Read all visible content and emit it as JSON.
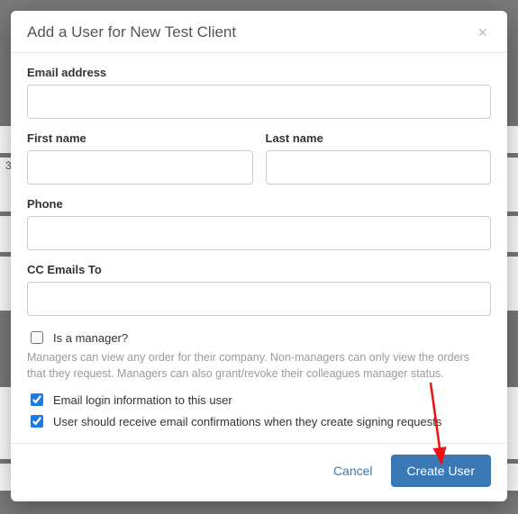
{
  "modal": {
    "title": "Add a User for New Test Client",
    "close": "×",
    "fields": {
      "email_label": "Email address",
      "first_name_label": "First name",
      "last_name_label": "Last name",
      "phone_label": "Phone",
      "cc_label": "CC Emails To",
      "email_value": "",
      "first_name_value": "",
      "last_name_value": "",
      "phone_value": "",
      "cc_value": ""
    },
    "checkboxes": {
      "is_manager_label": "Is a manager?",
      "is_manager_checked": false,
      "manager_help": "Managers can view any order for their company. Non-managers can only view the orders that they request. Managers can also grant/revoke their colleagues manager status.",
      "email_login_label": "Email login information to this user",
      "email_login_checked": true,
      "email_confirm_label": "User should receive email confirmations when they create signing requests",
      "email_confirm_checked": true
    },
    "footer": {
      "cancel": "Cancel",
      "submit": "Create User"
    }
  }
}
